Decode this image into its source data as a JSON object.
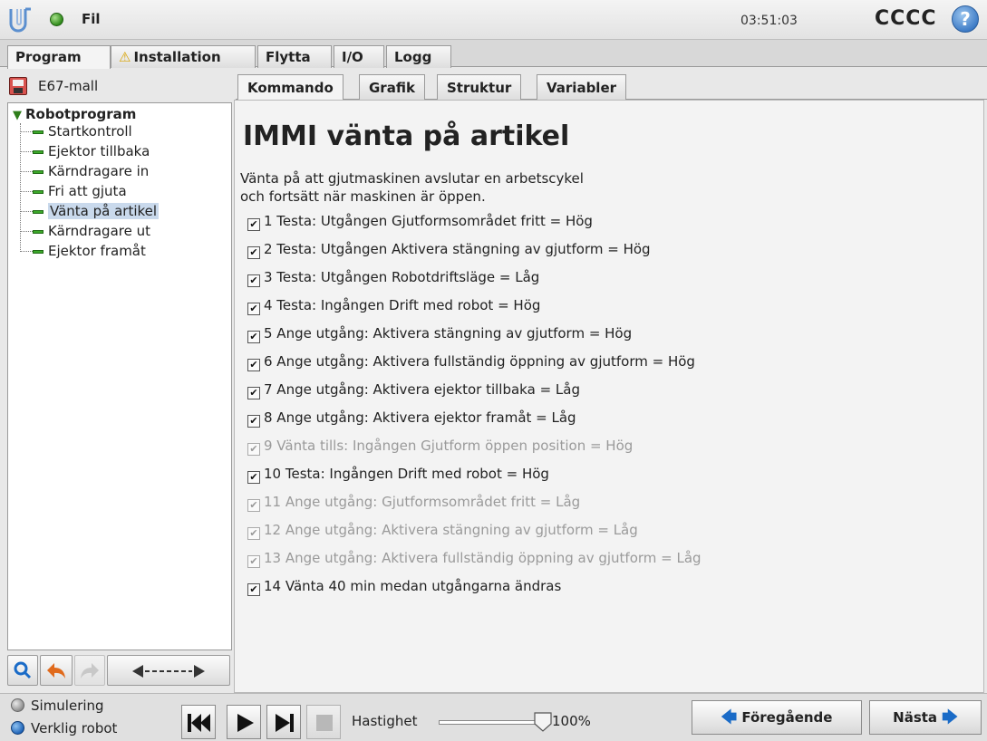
{
  "titlebar": {
    "file_menu": "Fil",
    "clock": "03:51:03",
    "robot_name": "CCCC",
    "help_symbol": "?"
  },
  "main_tabs": [
    {
      "label": "Program",
      "active": true
    },
    {
      "label": "Installation",
      "warning": true
    },
    {
      "label": "Flytta"
    },
    {
      "label": "I/O"
    },
    {
      "label": "Logg"
    }
  ],
  "program": {
    "name": "E67-mall",
    "tree_root": "Robotprogram",
    "tree_items": [
      {
        "label": "Startkontroll"
      },
      {
        "label": "Ejektor tillbaka"
      },
      {
        "label": "Kärndragare in"
      },
      {
        "label": "Fri att gjuta"
      },
      {
        "label": "Vänta på artikel",
        "selected": true
      },
      {
        "label": "Kärndragare ut"
      },
      {
        "label": "Ejektor framåt"
      }
    ],
    "toolbar_icons": [
      "search-icon",
      "undo-icon",
      "redo-icon",
      "move-arrows-icon"
    ]
  },
  "sub_tabs": [
    {
      "label": "Kommando",
      "active": true
    },
    {
      "label": "Grafik"
    },
    {
      "label": "Struktur"
    },
    {
      "label": "Variabler"
    }
  ],
  "command": {
    "heading": "IMMI vänta på artikel",
    "description_line1": "Vänta på att gjutmaskinen avslutar en arbetscykel",
    "description_line2": "och fortsätt när maskinen är öppen.",
    "checkmark": "✔",
    "items": [
      {
        "label": "1 Testa: Utgången Gjutformsområdet fritt = Hög",
        "checked": true,
        "enabled": true
      },
      {
        "label": "2 Testa: Utgången Aktivera stängning av gjutform = Hög",
        "checked": true,
        "enabled": true
      },
      {
        "label": "3 Testa: Utgången Robotdriftsläge = Låg",
        "checked": true,
        "enabled": true
      },
      {
        "label": "4 Testa: Ingången Drift med robot = Hög",
        "checked": true,
        "enabled": true
      },
      {
        "label": "5 Ange utgång: Aktivera stängning av gjutform = Hög",
        "checked": true,
        "enabled": true
      },
      {
        "label": "6 Ange utgång: Aktivera fullständig öppning av gjutform = Hög",
        "checked": true,
        "enabled": true
      },
      {
        "label": "7 Ange utgång: Aktivera ejektor tillbaka = Låg",
        "checked": true,
        "enabled": true
      },
      {
        "label": "8 Ange utgång: Aktivera ejektor framåt = Låg",
        "checked": true,
        "enabled": true
      },
      {
        "label": "9 Vänta tills: Ingången Gjutform öppen position = Hög",
        "checked": true,
        "enabled": false
      },
      {
        "label": "10 Testa: Ingången Drift med robot = Hög",
        "checked": true,
        "enabled": true
      },
      {
        "label": "11 Ange utgång: Gjutformsområdet fritt = Låg",
        "checked": true,
        "enabled": false
      },
      {
        "label": "12 Ange utgång: Aktivera stängning av gjutform = Låg",
        "checked": true,
        "enabled": false
      },
      {
        "label": "13 Ange utgång: Aktivera fullständig öppning av gjutform = Låg",
        "checked": true,
        "enabled": false
      },
      {
        "label": "14 Vänta 40 min medan utgångarna ändras",
        "checked": true,
        "enabled": true
      }
    ]
  },
  "bottombar": {
    "simulation_label": "Simulering",
    "real_robot_label": "Verklig robot",
    "real_robot_selected": true,
    "speed_label": "Hastighet",
    "speed_value": "100%",
    "speed_fraction": 1.0,
    "prev_label": "Föregående",
    "next_label": "Nästa",
    "accent_color": "#1a6bc7"
  }
}
